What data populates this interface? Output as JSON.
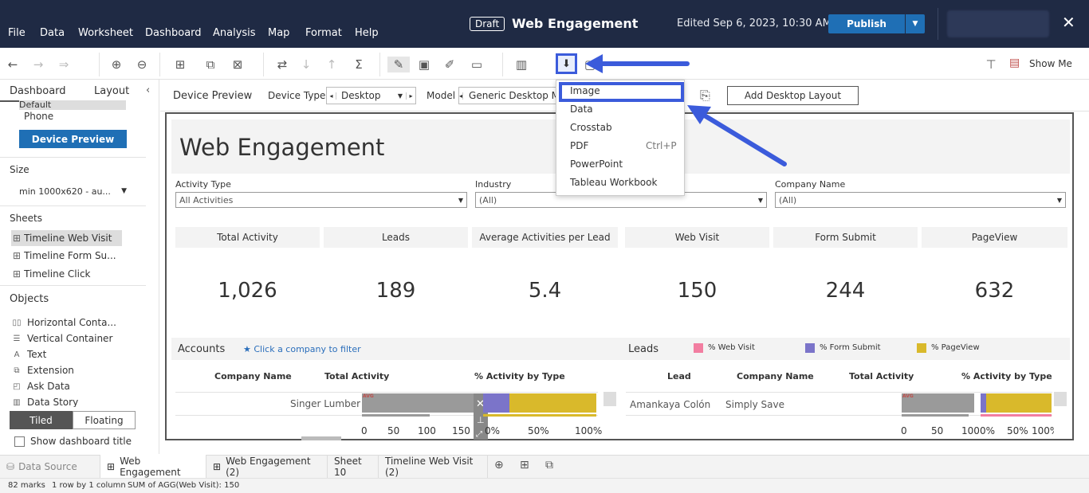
{
  "menubar": {
    "items": [
      "File",
      "Data",
      "Worksheet",
      "Dashboard",
      "Analysis",
      "Map",
      "Format",
      "Help"
    ],
    "draft_badge": "Draft",
    "workbook_title": "Web Engagement",
    "edited": "Edited Sep 6, 2023, 10:30 AM",
    "publish_label": "Publish"
  },
  "toolbar": {
    "show_me_label": "Show Me"
  },
  "left_panel": {
    "tabs": [
      "Dashboard",
      "Layout"
    ],
    "device_list": [
      "Default",
      "Phone"
    ],
    "device_preview_button": "Device Preview",
    "size_heading": "Size",
    "size_value": "min 1000x620 - au...",
    "sheets_heading": "Sheets",
    "sheets": [
      "Timeline Web Visit",
      "Timeline Form Su...",
      "Timeline Click"
    ],
    "objects_heading": "Objects",
    "objects": [
      "Horizontal Conta...",
      "Vertical Container",
      "Text",
      "Extension",
      "Ask Data",
      "Data Story"
    ],
    "tiled": "Tiled",
    "floating": "Floating",
    "show_title": "Show dashboard title"
  },
  "device_bar": {
    "preview_label": "Device Preview",
    "device_type_label": "Device Type",
    "device_type_value": "Desktop",
    "model_label": "Model",
    "model_value": "Generic Desktop M",
    "add_layout": "Add Desktop Layout"
  },
  "export_menu": {
    "items": [
      "Image",
      "Data",
      "Crosstab",
      "PDF",
      "PowerPoint",
      "Tableau Workbook"
    ],
    "pdf_shortcut": "Ctrl+P"
  },
  "dashboard": {
    "title": "Web Engagement",
    "filters": [
      {
        "label": "Activity Type",
        "value": "All Activities"
      },
      {
        "label": "Industry",
        "value": "(All)"
      },
      {
        "label": "Company Name",
        "value": "(All)"
      }
    ],
    "kpis": [
      {
        "label": "Total Activity",
        "value": "1,026"
      },
      {
        "label": "Leads",
        "value": "189"
      },
      {
        "label": "Average Activities per Lead",
        "value": "5.4"
      },
      {
        "label": "Web Visit",
        "value": "150"
      },
      {
        "label": "Form Submit",
        "value": "244"
      },
      {
        "label": "PageView",
        "value": "632"
      }
    ],
    "accounts": {
      "title": "Accounts",
      "hint": "★ Click a company to filter",
      "columns": [
        "Company Name",
        "Total Activity",
        "% Activity by Type"
      ],
      "row_company": "Singer Lumber",
      "bar_badge": "AVG",
      "activity_axis": [
        "0",
        "50",
        "100",
        "150"
      ],
      "pct_axis": [
        "0%",
        "50%",
        "100%"
      ]
    },
    "leads": {
      "title": "Leads",
      "legend": [
        "% Web Visit",
        "% Form Submit",
        "% PageView"
      ],
      "columns": [
        "Lead",
        "Company Name",
        "Total Activity",
        "% Activity by Type"
      ],
      "row_lead": "Amankaya Colón",
      "row_company": "Simply Save",
      "activity_axis": [
        "0",
        "50",
        "100"
      ],
      "pct_axis": [
        "0%",
        "50%",
        "100%"
      ]
    },
    "colors": {
      "web_visit": "#f27ea1",
      "form_submit": "#7b74c9",
      "pageview": "#d9b92b",
      "total_bar": "#9a9a9a"
    }
  },
  "sheet_tabs": [
    "Data Source",
    "Web Engagement",
    "Web Engagement (2)",
    "Sheet 10",
    "Timeline Web Visit (2)"
  ],
  "status_bar": {
    "marks": "82 marks",
    "rows": "1 row by 1 column",
    "sum": "SUM of AGG(Web Visit): 150"
  }
}
